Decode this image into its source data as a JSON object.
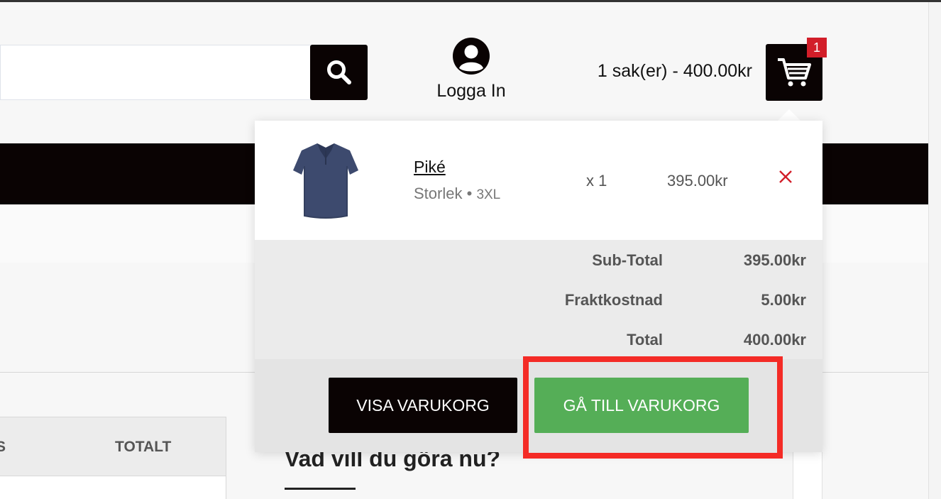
{
  "search": {
    "placeholder": "",
    "button_icon": "search-icon"
  },
  "account": {
    "icon": "user-icon",
    "login_label": "Logga In"
  },
  "cart": {
    "summary": "1 sak(er) - 400.00kr",
    "icon": "cart-icon",
    "badge_count": "1"
  },
  "dropdown": {
    "items": [
      {
        "image": "polo-shirt-icon",
        "name": "Piké",
        "option_label": "Storlek",
        "option_value": "3XL",
        "quantity": "x 1",
        "price": "395.00kr",
        "remove_icon": "close-icon"
      }
    ],
    "totals": [
      {
        "label": "Sub-Total",
        "value": "395.00kr"
      },
      {
        "label": "Fraktkostnad",
        "value": "5.00kr"
      },
      {
        "label": "Total",
        "value": "400.00kr"
      }
    ],
    "buttons": {
      "view_cart": "VISA VARUKORG",
      "checkout": "GÅ TILL VARUKORG"
    }
  },
  "page": {
    "table_headers": [
      "S",
      "TOTALT"
    ],
    "whatnext_heading": "Vad vill du göra nu?"
  },
  "colors": {
    "dark": "#0a0303",
    "accent_green": "#55ae57",
    "badge_red": "#d21e29",
    "highlight_red": "#f42b26"
  }
}
